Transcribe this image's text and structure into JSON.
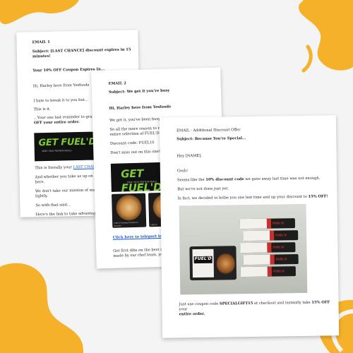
{
  "colors": {
    "accent_orange": "#f6b12a",
    "link": "#1a56c4",
    "brand_green": "#7cc93a",
    "tray_red": "#c8302c"
  },
  "email1": {
    "label": "EMAIL 1",
    "subject": "Subject: [LAST CHANCE] discount expires in 15 minutes!",
    "preheader": "Your 10% OFF Coupon Expires In...",
    "greeting": "Hi, Harley here from Yesfoods",
    "line1": "I hate to break it to you but...",
    "line2": "This is it.",
    "line3": "...Your one last reminder to grab ou",
    "line4": "OFF your entire order.",
    "banner_brand": "GET FUEL'D",
    "banner_tag": "'NEW' HIGH PROTEIN MEALS",
    "line5a": "This is literally your ",
    "line5_link": "LAST CHANCE",
    "line6": "And whether you take us up on our offe",
    "line7": "here.",
    "line8": "We don't take our mission of making Au",
    "line9": "lightly.",
    "line10": "So with that said...",
    "line11": "Here's the link to take advantage of thi"
  },
  "email2": {
    "label": "EMAIL 2",
    "subject": "Subject: We get it you're busy",
    "greeting": "Hi, Harley here from Yesfoods",
    "line1": "We get it, you've been busy.",
    "line2": "So all the more reason to reminde",
    "line3": "entire selection of FUEL'D Large",
    "line4": "Discount code: FUEL10",
    "line5": "Don't miss out on this one! Gone",
    "banner_brand": "GET FUEL'D",
    "banner_tag": "'NEW' HIGH PROTEIN MEALS",
    "meal1": "FUEL'D Smoked Chicken & Gnocchi",
    "meal2": "FUEL'D",
    "link": "Click here to teleport instan",
    "line6": "Get first dibs on the best meal la",
    "line7": "made by our chef team, you'll wo"
  },
  "email3": {
    "label": "EMAIL - Additional Discount Offer",
    "subject": "Subject: Because You're Special...",
    "greeting": "Hey [NAME],",
    "line1": "Gosh!",
    "line2a": "Seems like the ",
    "line2b": "10% discount code",
    "line2c": " we gave away last time was not enough.",
    "line3": "But we're not done just yet.",
    "line4a": "In fact, we decided to bribe you one last time and up your discount to ",
    "line4b": "15% OFF!",
    "photo_brand": "FUEL'D",
    "tray_brand": "FUEL'D",
    "line5a": "Just use coupon code ",
    "line5b": "SPECIALGIFT15",
    "line5c": " at checkout and instantly take ",
    "line5d": "15% OFF",
    "line5e": " your",
    "line6": "entire order."
  }
}
